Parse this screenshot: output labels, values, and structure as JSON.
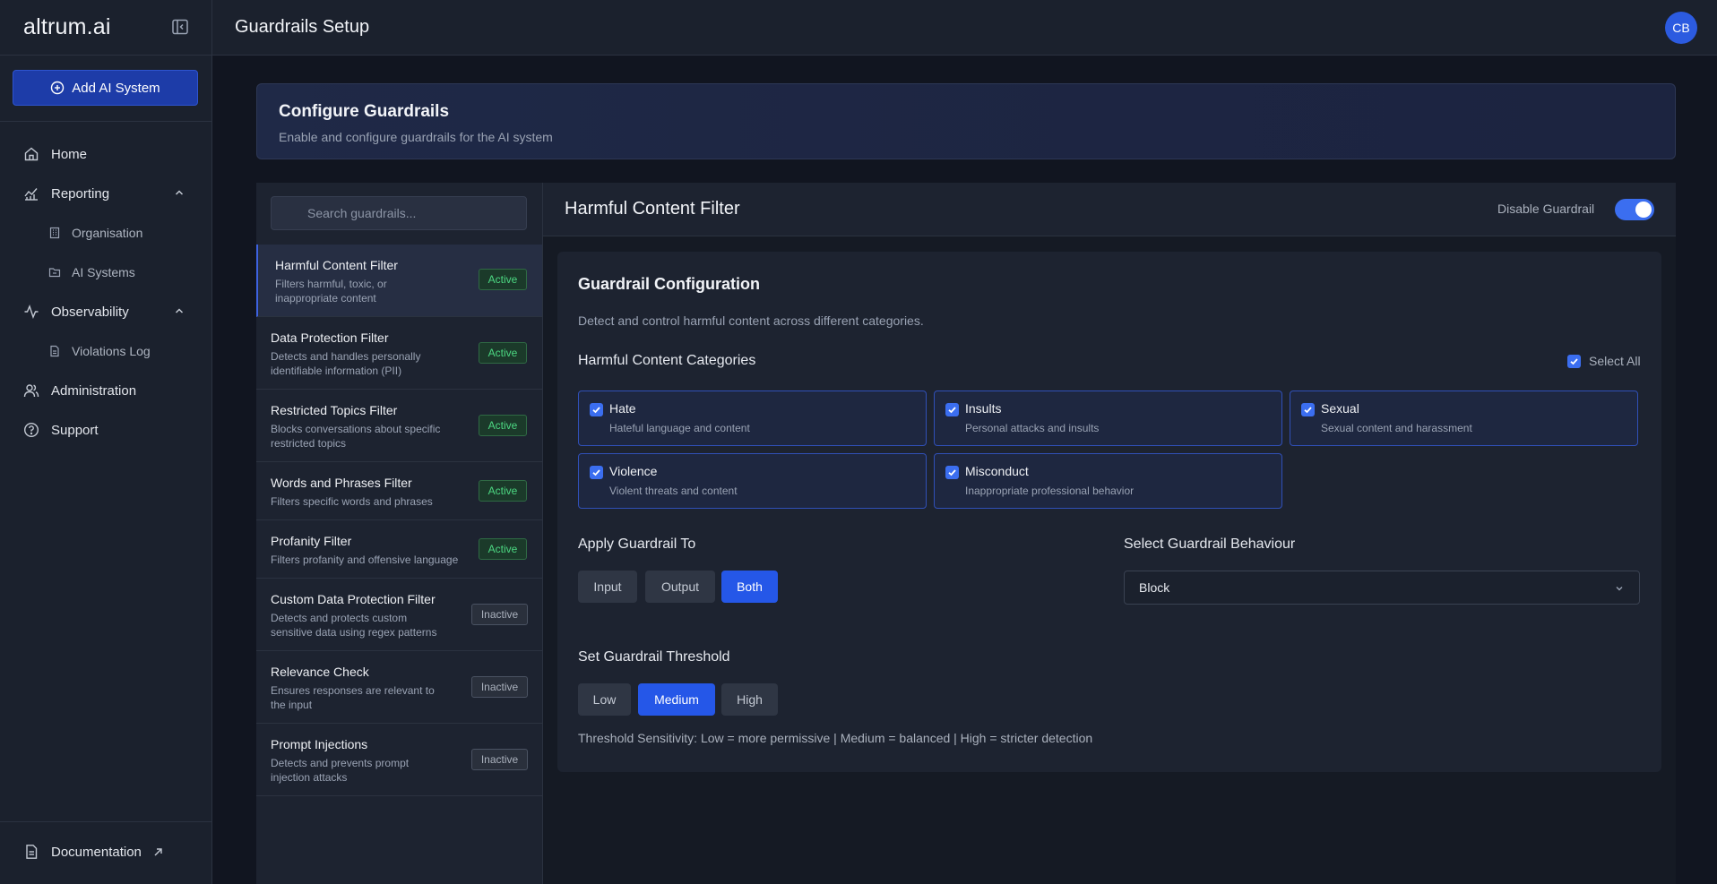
{
  "brand": {
    "name": "altrum.ai"
  },
  "sidebar": {
    "add_label": "Add AI System",
    "items": [
      {
        "label": "Home",
        "icon": "home-icon"
      },
      {
        "label": "Reporting",
        "icon": "chart-icon",
        "expanded": true
      },
      {
        "label": "Organisation",
        "icon": "building-icon"
      },
      {
        "label": "AI Systems",
        "icon": "folder-icon"
      },
      {
        "label": "Observability",
        "icon": "activity-icon",
        "expanded": true
      },
      {
        "label": "Violations Log",
        "icon": "file-icon"
      },
      {
        "label": "Administration",
        "icon": "users-icon"
      },
      {
        "label": "Support",
        "icon": "help-icon"
      }
    ],
    "docs_label": "Documentation"
  },
  "header": {
    "title": "Guardrails Setup",
    "avatar": "CB"
  },
  "banner": {
    "title": "Configure Guardrails",
    "subtitle": "Enable and configure guardrails for the AI system"
  },
  "search": {
    "placeholder": "Search guardrails..."
  },
  "guardrails": [
    {
      "name": "Harmful Content Filter",
      "desc": "Filters harmful, toxic, or inappropriate content",
      "status": "Active"
    },
    {
      "name": "Data Protection Filter",
      "desc": "Detects and handles personally identifiable information (PII)",
      "status": "Active"
    },
    {
      "name": "Restricted Topics Filter",
      "desc": "Blocks conversations about specific restricted topics",
      "status": "Active"
    },
    {
      "name": "Words and Phrases Filter",
      "desc": "Filters specific words and phrases",
      "status": "Active"
    },
    {
      "name": "Profanity Filter",
      "desc": "Filters profanity and offensive language",
      "status": "Active"
    },
    {
      "name": "Custom Data Protection Filter",
      "desc": "Detects and protects custom sensitive data using regex patterns",
      "status": "Inactive"
    },
    {
      "name": "Relevance Check",
      "desc": "Ensures responses are relevant to the input",
      "status": "Inactive"
    },
    {
      "name": "Prompt Injections",
      "desc": "Detects and prevents prompt injection attacks",
      "status": "Inactive"
    }
  ],
  "detail": {
    "title": "Harmful Content Filter",
    "disable_label": "Disable Guardrail",
    "enabled": true,
    "config_title": "Guardrail Configuration",
    "config_desc": "Detect and control harmful content across different categories.",
    "categories_title": "Harmful Content Categories",
    "select_all": "Select All",
    "categories": [
      {
        "name": "Hate",
        "desc": "Hateful language and content",
        "checked": true
      },
      {
        "name": "Insults",
        "desc": "Personal attacks and insults",
        "checked": true
      },
      {
        "name": "Sexual",
        "desc": "Sexual content and harassment",
        "checked": true
      },
      {
        "name": "Violence",
        "desc": "Violent threats and content",
        "checked": true
      },
      {
        "name": "Misconduct",
        "desc": "Inappropriate professional behavior",
        "checked": true
      }
    ],
    "apply_title": "Apply Guardrail To",
    "apply_options": [
      "Input",
      "Output",
      "Both"
    ],
    "apply_selected": "Both",
    "behaviour_title": "Select Guardrail Behaviour",
    "behaviour_value": "Block",
    "threshold_title": "Set Guardrail Threshold",
    "threshold_options": [
      "Low",
      "Medium",
      "High"
    ],
    "threshold_selected": "Medium",
    "threshold_note": "Threshold Sensitivity: Low = more permissive | Medium = balanced | High = stricter detection"
  },
  "colors": {
    "accent": "#2557e8",
    "active_badge": "#4cd882",
    "bg": "#111520",
    "panel": "#1d2330"
  }
}
